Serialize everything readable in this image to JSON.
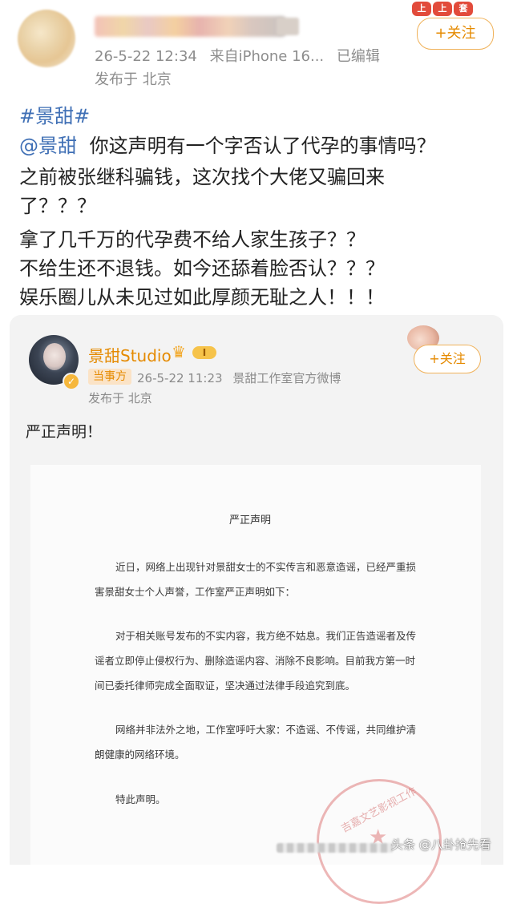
{
  "post": {
    "timestamp": "26-5-22 12:34",
    "source": "来自iPhone 16...",
    "edited": "已编辑",
    "location": "发布于 北京",
    "follow_label": "+关注",
    "stickers": [
      "上",
      "上",
      "套"
    ],
    "lines": [
      "#景甜#",
      "你这声明有一个字否认了代孕的事情吗？",
      "之前被张继科骗钱，这次找个大佬又骗回来",
      "了？？？",
      "拿了几千万的代孕费不给人家生孩子？？",
      "不给生还不退钱。如今还舔着脸否认？？？",
      "娱乐圈儿从未见过如此厚颜无耻之人！！！"
    ],
    "mention": "@景甜"
  },
  "repost": {
    "account_name": "景甜Studio",
    "level": "I",
    "party_tag": "当事方",
    "timestamp": "26-5-22 11:23",
    "description": "景甜工作室官方微博",
    "location": "发布于 北京",
    "follow_label": "+关注",
    "text": "严正声明！"
  },
  "statement": {
    "title": "严正声明",
    "paragraphs": [
      "近日，网络上出现针对景甜女士的不实传言和恶意造谣，已经严重损害景甜女士个人声誉，工作室严正声明如下：",
      "对于相关账号发布的不实内容，我方绝不姑息。我们正告造谣者及传谣者立即停止侵权行为、删除造谣内容、消除不良影响。目前我方第一时间已委托律师完成全面取证，坚决通过法律手段追究到底。",
      "网络并非法外之地，工作室呼吁大家：不造谣、不传谣，共同维护清朗健康的网络环境。"
    ],
    "closing": "特此声明。",
    "seal_text": "吉嘉文艺影视工作"
  },
  "watermark": "头条 @八卦抢先看",
  "colors": {
    "accent_orange": "#e58a00",
    "link_blue": "#3f6fb5",
    "seal_red": "#d65f5f"
  }
}
